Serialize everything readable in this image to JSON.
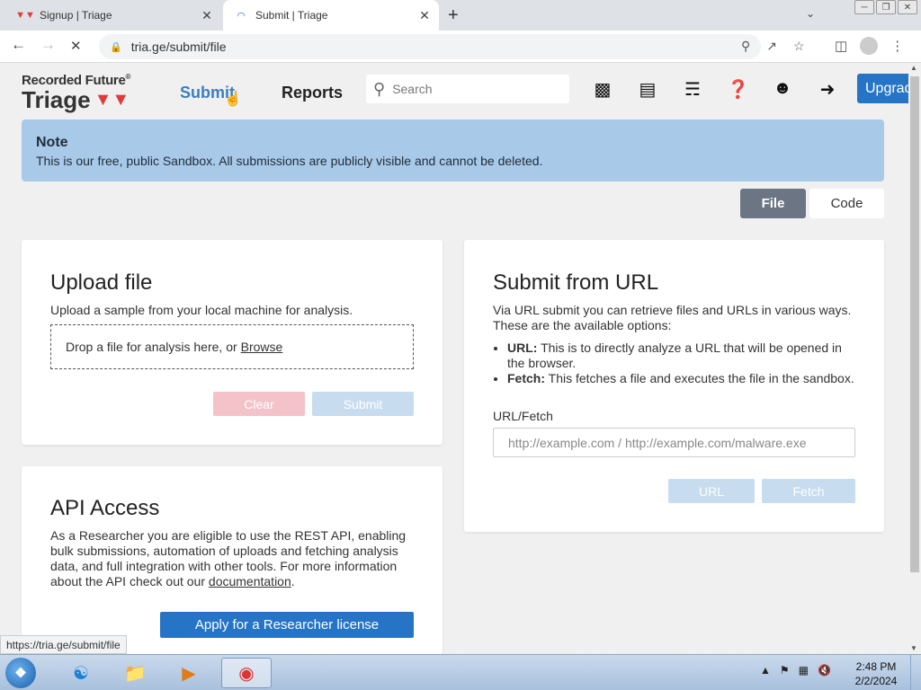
{
  "browser": {
    "tabs": [
      {
        "title": "Signup | Triage",
        "favicon": "triage-favicon"
      },
      {
        "title": "Submit | Triage",
        "favicon": "loading-spinner"
      }
    ],
    "new_tab_symbol": "+",
    "url": "tria.ge/submit/file"
  },
  "site": {
    "brand_top": "Recorded Future",
    "brand_reg": "®",
    "brand_name": "Triage",
    "nav": {
      "submit": "Submit",
      "reports": "Reports"
    },
    "search_placeholder": "Search",
    "upgrade": "Upgrade"
  },
  "note": {
    "heading": "Note",
    "text": "This is our free, public Sandbox. All submissions are publicly visible and cannot be deleted."
  },
  "toggle": {
    "file": "File",
    "code": "Code"
  },
  "upload": {
    "title": "Upload file",
    "description": "Upload a sample from your local machine for analysis.",
    "drop_text": "Drop a file for analysis here, or",
    "browse": "Browse",
    "clear": "Clear",
    "submit": "Submit"
  },
  "url_submit": {
    "title": "Submit from URL",
    "description": "Via URL submit you can retrieve files and URLs in various ways. These are the available options:",
    "options": [
      {
        "name": "URL:",
        "text": "This is to directly analyze a URL that will be opened in the browser."
      },
      {
        "name": "Fetch:",
        "text": "This fetches a file and executes the file in the sandbox."
      }
    ],
    "label": "URL/Fetch",
    "placeholder": "http://example.com / http://example.com/malware.exe",
    "url_button": "URL",
    "fetch_button": "Fetch"
  },
  "api": {
    "title": "API Access",
    "text": "As a Researcher you are eligible to use the REST API, enabling bulk submissions, automation of uploads and fetching analysis data, and full integration with other tools. For more information about the API check out our",
    "link": "documentation",
    "link_suffix": ".",
    "apply": "Apply for a Researcher license"
  },
  "status_url": "https://tria.ge/submit/file",
  "taskbar": {
    "time": "2:48 PM",
    "date": "2/2/2024"
  }
}
